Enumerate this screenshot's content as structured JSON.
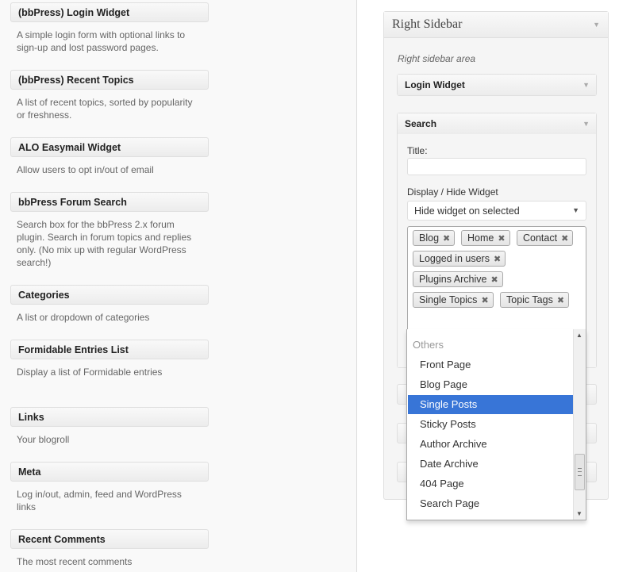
{
  "available_widgets": [
    {
      "title": "(bbPress) Login Widget",
      "description": "A simple login form with optional links to sign-up and lost password pages."
    },
    {
      "title": "(bbPress) Recent Topics",
      "description": "A list of recent topics, sorted by popularity or freshness."
    },
    {
      "title": "ALO Easymail Widget",
      "description": "Allow users to opt in/out of email"
    },
    {
      "title": "bbPress Forum Search",
      "description": "Search box for the bbPress 2.x forum plugin. Search in forum topics and replies only. (No mix up with regular WordPress search!)"
    },
    {
      "title": "Categories",
      "description": "A list or dropdown of categories"
    },
    {
      "title": "Formidable Entries List",
      "description": "Display a list of Formidable entries"
    },
    {
      "title": "Links",
      "description": "Your blogroll"
    },
    {
      "title": "Meta",
      "description": "Log in/out, admin, feed and WordPress links"
    },
    {
      "title": "Recent Comments",
      "description": "The most recent comments"
    }
  ],
  "sidebar": {
    "title": "Right Sidebar",
    "description": "Right sidebar area",
    "login_widget_title": "Login Widget",
    "search_widget": {
      "title": "Search",
      "title_label": "Title:",
      "title_value": "",
      "display_label": "Display / Hide Widget",
      "display_selected": "Hide widget on selected",
      "tags": [
        "Blog",
        "Home",
        "Contact",
        "Logged in users",
        "Plugins Archive",
        "Single Topics",
        "Topic Tags"
      ]
    }
  },
  "dropdown": {
    "group_label": "Others",
    "options": [
      "Front Page",
      "Blog Page",
      "Single Posts",
      "Sticky Posts",
      "Author Archive",
      "Date Archive",
      "404 Page",
      "Search Page"
    ],
    "highlighted": "Single Posts"
  },
  "icons": {
    "collapse": "triangle-down-icon",
    "remove": "close-icon"
  },
  "colors": {
    "highlight": "#3875d7"
  }
}
